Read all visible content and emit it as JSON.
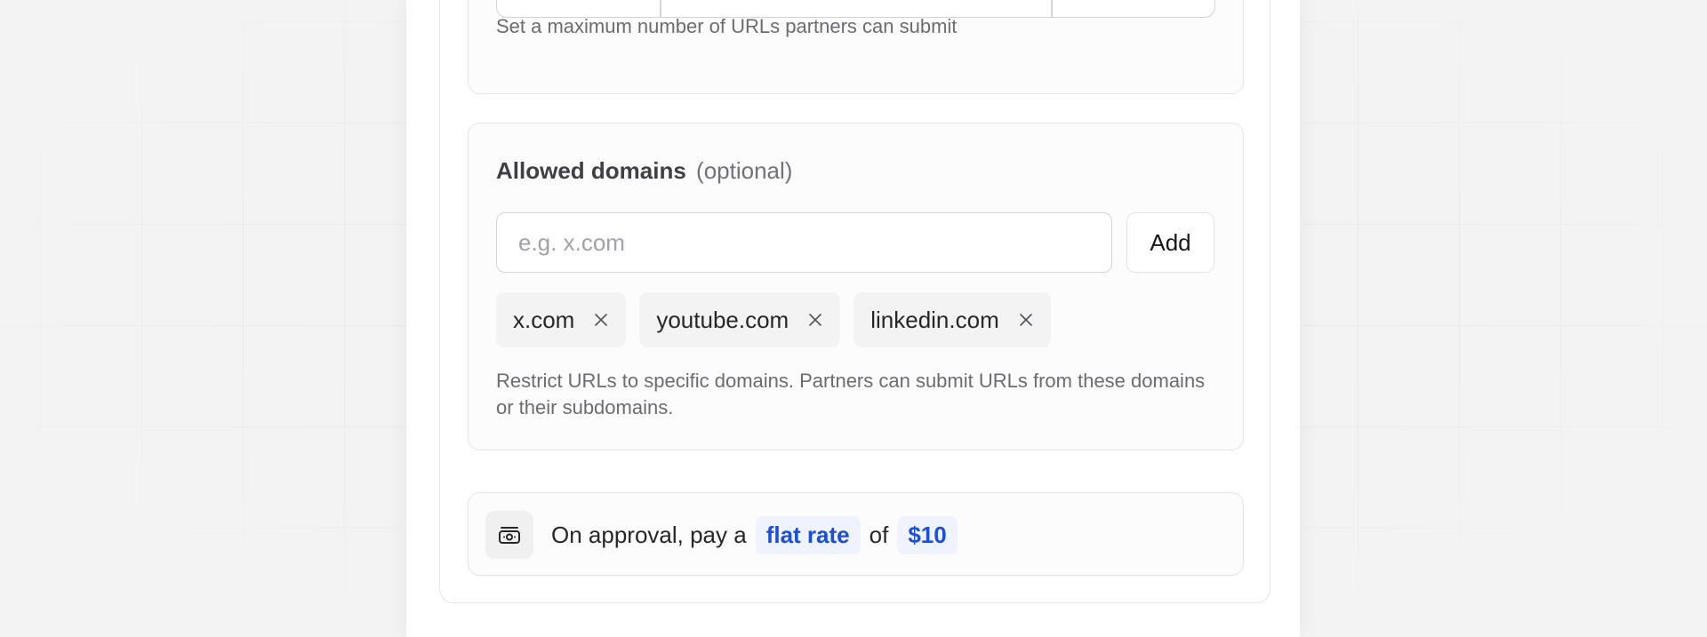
{
  "max_urls": {
    "help_text": "Set a maximum number of URLs partners can submit"
  },
  "allowed_domains": {
    "title": "Allowed domains",
    "optional_label": "(optional)",
    "input_placeholder": "e.g. x.com",
    "input_value": "",
    "add_label": "Add",
    "tags": [
      {
        "label": "x.com",
        "remove_icon": "close-icon"
      },
      {
        "label": "youtube.com",
        "remove_icon": "close-icon"
      },
      {
        "label": "linkedin.com",
        "remove_icon": "close-icon"
      }
    ],
    "help_text": "Restrict URLs to specific domains. Partners can submit URLs from these domains or their subdomains."
  },
  "reward": {
    "icon": "money-icon",
    "prefix": "On approval, pay a",
    "rate_type": "flat rate",
    "connector": "of",
    "amount": "$10"
  },
  "colors": {
    "accent": "#1d4ed8",
    "pill_bg": "#eef3ff",
    "border": "#e4e4e7"
  }
}
